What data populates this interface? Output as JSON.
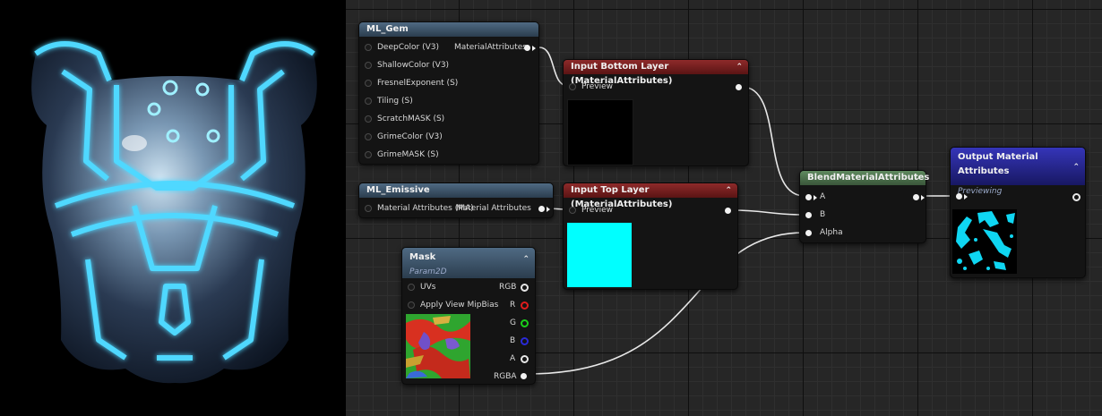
{
  "nodes": {
    "ml_gem": {
      "title": "ML_Gem",
      "inputs": [
        "DeepColor (V3)",
        "ShallowColor (V3)",
        "FresnelExponent (S)",
        "Tiling (S)",
        "ScratchMASK (S)",
        "GrimeColor (V3)",
        "GrimeMASK (S)"
      ],
      "output": "MaterialAttributes"
    },
    "ml_emissive": {
      "title": "ML_Emissive",
      "input": "Material Attributes (MA)",
      "output": "Material Attributes"
    },
    "input_bottom": {
      "title": "Input Bottom Layer (MaterialAttributes)",
      "pin": "Preview"
    },
    "input_top": {
      "title": "Input Top Layer (MaterialAttributes)",
      "pin": "Preview"
    },
    "mask": {
      "title": "Mask",
      "subtitle": "Param2D",
      "inputs": [
        "UVs",
        "Apply View MipBias"
      ],
      "outputs": [
        "RGB",
        "R",
        "G",
        "B",
        "A",
        "RGBA"
      ]
    },
    "blend": {
      "title": "BlendMaterialAttributes",
      "inputs": [
        "A",
        "B",
        "Alpha"
      ]
    },
    "output": {
      "title": "Output Material Attributes",
      "subtitle": "Previewing"
    }
  },
  "icons": {
    "collapse": "chevron-up-icon",
    "expand": "chevron-down-icon"
  },
  "colors": {
    "emissive_preview": "#00ffff",
    "bottom_preview": "#000000",
    "armor_glow": "#3cc8ff",
    "wire": "#e8e8e8",
    "output_header": "#2a2a9a",
    "blend_header": "#4d724d",
    "input_header": "#7a2020",
    "function_header": "#3d5468"
  }
}
